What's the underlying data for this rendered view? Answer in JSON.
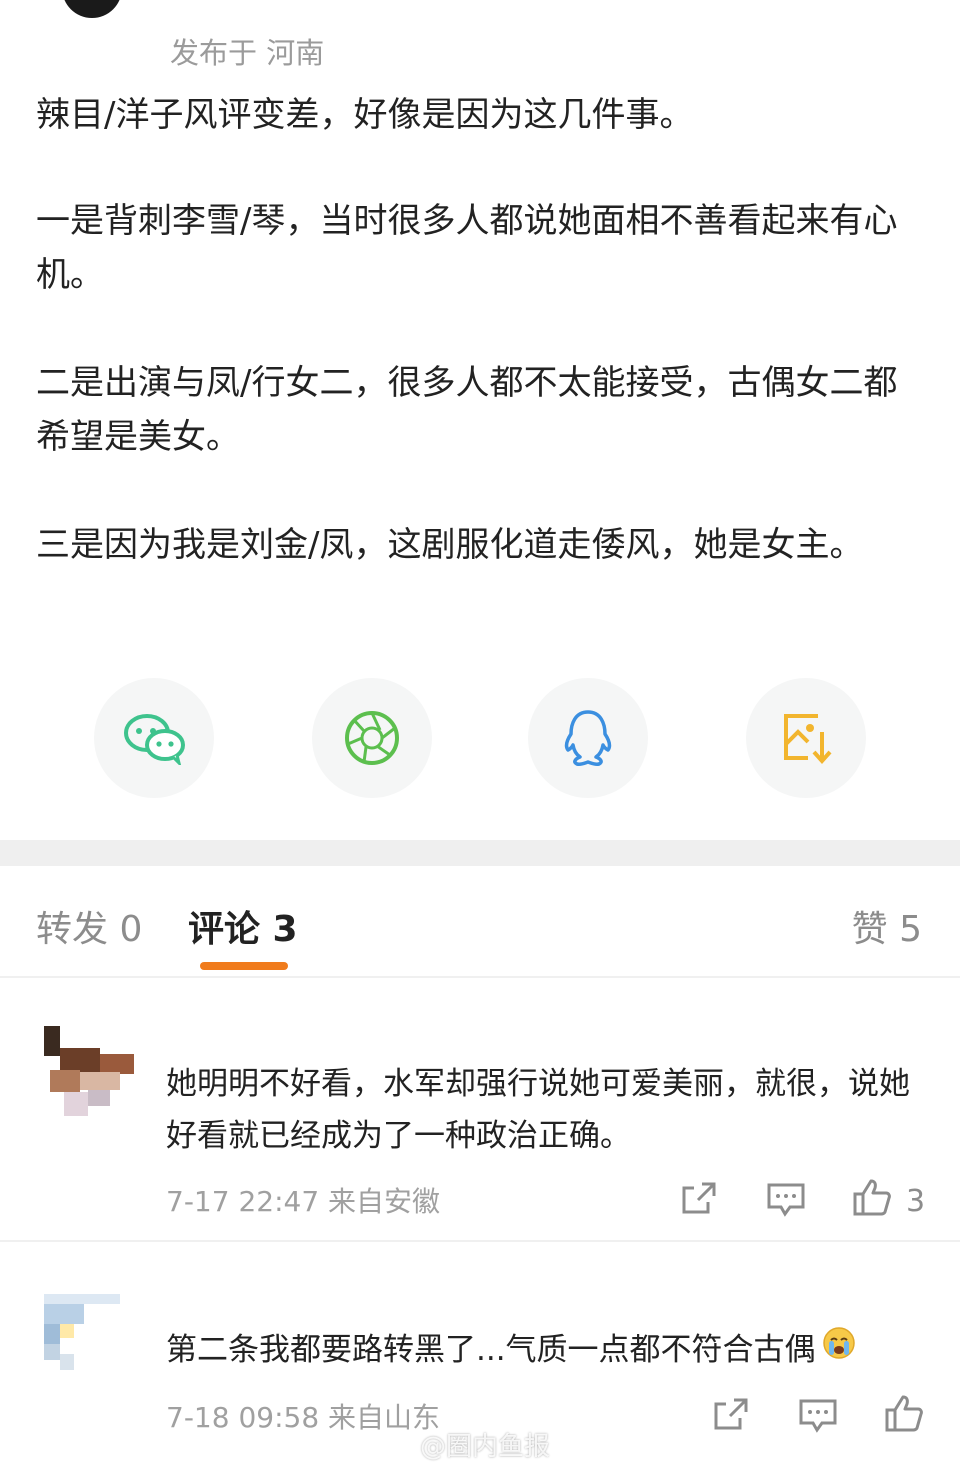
{
  "post": {
    "location": "发布于 河南",
    "paragraphs": [
      "辣目/洋子风评变差，好像是因为这几件事。",
      "一是背刺李雪/琴，当时很多人都说她面相不善看起来有心机。",
      "二是出演与凤/行女二，很多人都不太能接受，古偶女二都希望是美女。",
      "三是因为我是刘金/凤，这剧服化道走倭风，她是女主。"
    ]
  },
  "share": [
    {
      "icon": "wechat-icon",
      "color": "#3ec38d"
    },
    {
      "icon": "moments-icon",
      "color": "#5cbf4e"
    },
    {
      "icon": "qq-icon",
      "color": "#3b8fe0"
    },
    {
      "icon": "save-image-icon",
      "color": "#f2b52e"
    }
  ],
  "tabs": {
    "repost": "转发 0",
    "comments": "评论 3",
    "likes": "赞 5"
  },
  "comments": [
    {
      "text": "她明明不好看，水军却强行说她可爱美丽，就很，说她好看就已经成为了一种政治正确。",
      "meta": "7-17 22:47 来自安徽",
      "like_count": "3"
    },
    {
      "text": "第二条我都要路转黑了...气质一点都不符合古偶",
      "meta": "7-18 09:58 来自山东",
      "emoji": "crying-face-icon",
      "like_count": ""
    }
  ],
  "watermark": "@圈内鱼报",
  "accent_color": "#f07b1c"
}
